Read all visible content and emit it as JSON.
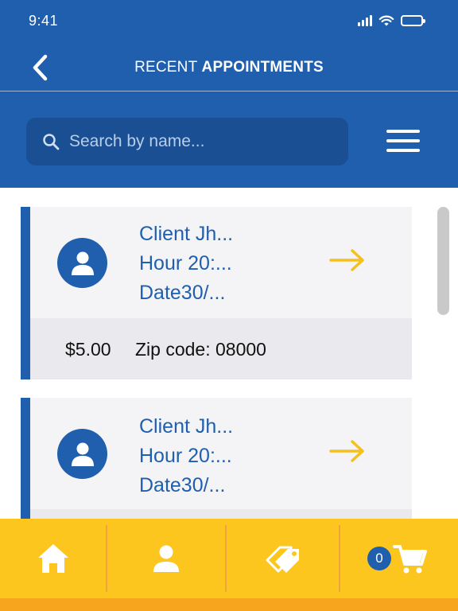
{
  "status_bar": {
    "time": "9:41"
  },
  "nav": {
    "title_light": "RECENT ",
    "title_bold": "APPOINTMENTS"
  },
  "search": {
    "placeholder": "Search by name..."
  },
  "appointments": [
    {
      "client": "Client Jh...",
      "hour": "Hour 20:...",
      "date": "Date30/...",
      "price": "$5.00",
      "zip": "Zip code: 08000"
    },
    {
      "client": "Client Jh...",
      "hour": "Hour 20:...",
      "date": "Date30/..."
    }
  ],
  "tabbar": {
    "cart_count": "0"
  },
  "colors": {
    "primary": "#1f5fae",
    "accent": "#fdc61f",
    "arrow": "#f5c01f",
    "strip": "#f7a51e"
  },
  "icons": [
    "back-icon",
    "search-icon",
    "menu-icon",
    "avatar-icon",
    "arrow-right-icon",
    "home-icon",
    "user-icon",
    "tag-icon",
    "cart-icon"
  ]
}
